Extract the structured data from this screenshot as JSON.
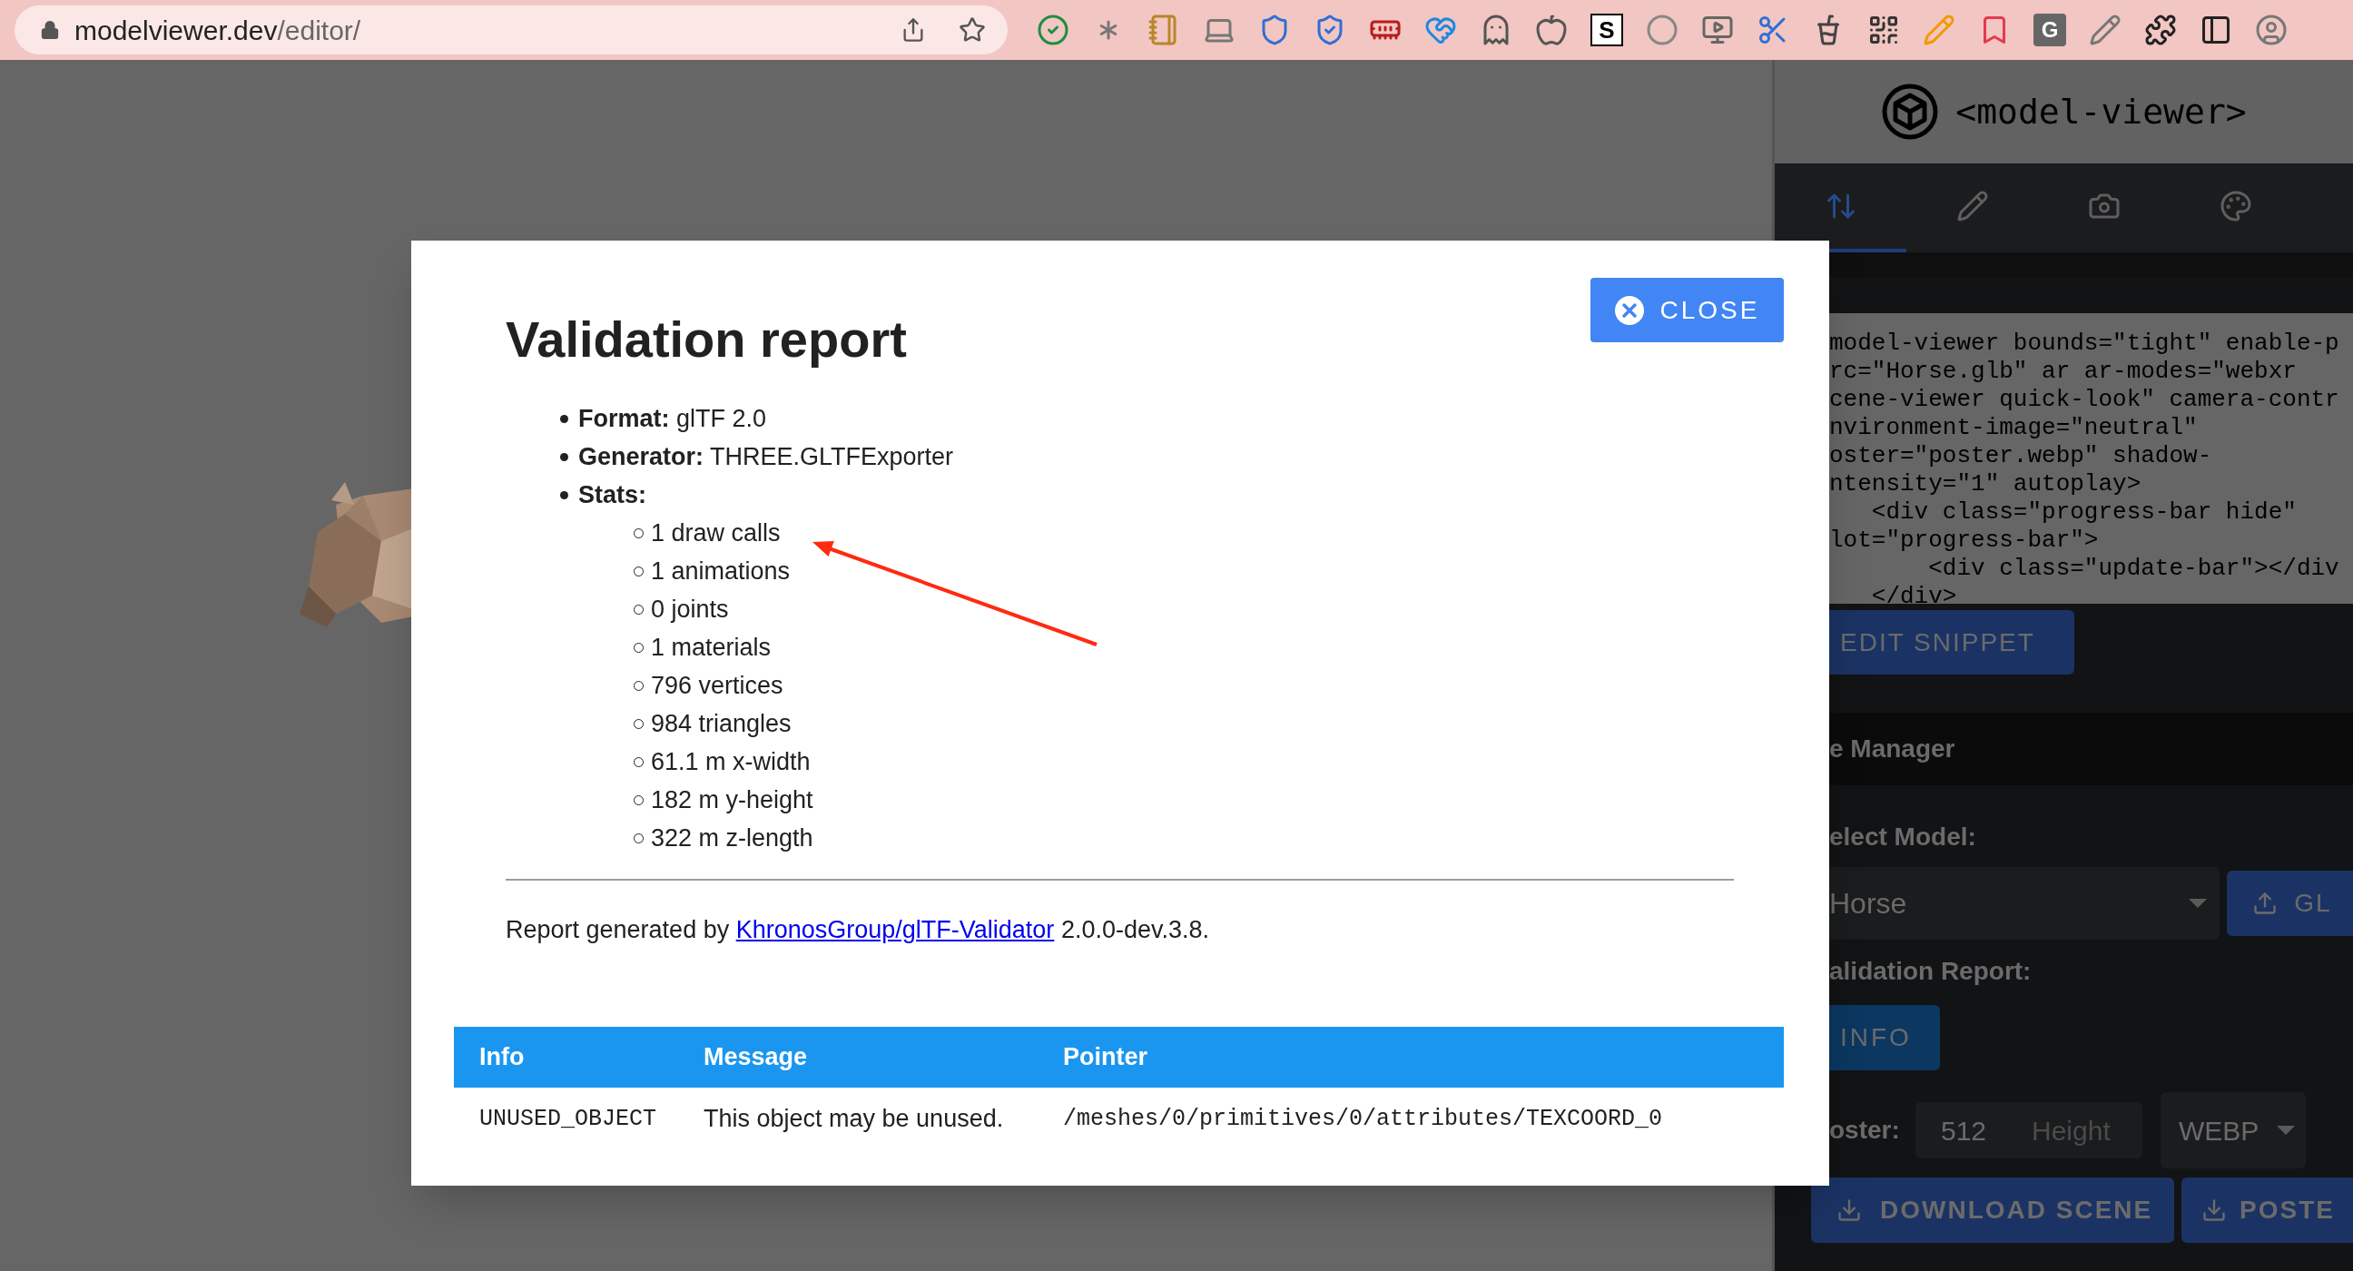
{
  "browser": {
    "url_host": "modelviewer.dev",
    "url_path": "/editor/",
    "extension_letters": [
      "S",
      "G"
    ]
  },
  "app_header": {
    "title": "<model-viewer>"
  },
  "tabs": [
    {
      "selected": true
    },
    {
      "selected": false
    },
    {
      "selected": false
    },
    {
      "selected": false
    }
  ],
  "snippet": {
    "lines": [
      "model-viewer bounds=\"tight\" enable-p",
      "rc=\"Horse.glb\" ar ar-modes=\"webxr",
      "cene-viewer quick-look\" camera-contr",
      "nvironment-image=\"neutral\"",
      "oster=\"poster.webp\" shadow-",
      "ntensity=\"1\" autoplay>",
      "   <div class=\"progress-bar hide\"",
      "lot=\"progress-bar\">",
      "       <div class=\"update-bar\"></div",
      "   </div>"
    ],
    "edit_button": "EDIT SNIPPET"
  },
  "manager": {
    "title": "e Manager",
    "select_label": "elect Model:",
    "model": "Horse",
    "upload_button": "GL",
    "report_label": "alidation Report:",
    "report_button": "INFO",
    "poster_label": "oster:",
    "width_value": "512",
    "height_placeholder": "Height",
    "format": "WEBP",
    "buttons": [
      "DOWNLOAD SCENE",
      "POSTE"
    ]
  },
  "dialog": {
    "close": "CLOSE",
    "title": "Validation report",
    "summary": [
      {
        "label": "Format:",
        "value": "glTF 2.0"
      },
      {
        "label": "Generator:",
        "value": "THREE.GLTFExporter"
      },
      {
        "label": "Stats:",
        "stats": [
          "1 draw calls",
          "1 animations",
          "0 joints",
          "1 materials",
          "796 vertices",
          "984 triangles",
          "61.1 m x-width",
          "182 m y-height",
          "322 m z-length"
        ]
      }
    ],
    "footer_prefix": "Report generated by",
    "footer_link": "KhronosGroup/glTF-Validator",
    "footer_suffix": "2.0.0-dev.3.8.",
    "table": {
      "columns": [
        "Info",
        "Message",
        "Pointer"
      ],
      "rows": [
        [
          "UNUSED_OBJECT",
          "This object may be unused.",
          "/meshes/0/primitives/0/attributes/TEXCOORD_0"
        ]
      ]
    }
  }
}
